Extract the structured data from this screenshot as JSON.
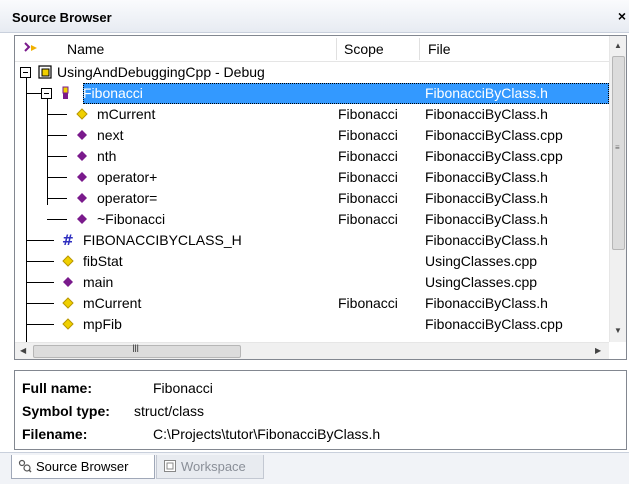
{
  "window": {
    "title": "Source Browser",
    "close_glyph": "×"
  },
  "columns": {
    "name": "Name",
    "scope": "Scope",
    "file": "File"
  },
  "rows": [
    {
      "name": "UsingAndDebuggingCpp - Debug",
      "scope": "",
      "file": "",
      "icon": "project-icon",
      "level": 0,
      "expander": "minus"
    },
    {
      "name": "Fibonacci",
      "scope": "",
      "file": "FibonacciByClass.h",
      "icon": "class-icon",
      "level": 1,
      "expander": "minus",
      "selected": true
    },
    {
      "name": "mCurrent",
      "scope": "Fibonacci",
      "file": "FibonacciByClass.h",
      "icon": "variable-icon",
      "level": 2
    },
    {
      "name": "next",
      "scope": "Fibonacci",
      "file": "FibonacciByClass.cpp",
      "icon": "function-icon",
      "level": 2
    },
    {
      "name": "nth",
      "scope": "Fibonacci",
      "file": "FibonacciByClass.cpp",
      "icon": "function-icon",
      "level": 2
    },
    {
      "name": "operator+",
      "scope": "Fibonacci",
      "file": "FibonacciByClass.h",
      "icon": "function-icon",
      "level": 2
    },
    {
      "name": "operator=",
      "scope": "Fibonacci",
      "file": "FibonacciByClass.h",
      "icon": "function-icon",
      "level": 2
    },
    {
      "name": "~Fibonacci",
      "scope": "Fibonacci",
      "file": "FibonacciByClass.h",
      "icon": "function-icon",
      "level": 2
    },
    {
      "name": "FIBONACCIBYCLASS_H",
      "scope": "",
      "file": "FibonacciByClass.h",
      "icon": "macro-icon",
      "level": 1
    },
    {
      "name": "fibStat",
      "scope": "",
      "file": "UsingClasses.cpp",
      "icon": "variable-icon",
      "level": 1
    },
    {
      "name": "main",
      "scope": "",
      "file": "UsingClasses.cpp",
      "icon": "function-icon",
      "level": 1
    },
    {
      "name": "mCurrent",
      "scope": "Fibonacci",
      "file": "FibonacciByClass.h",
      "icon": "variable-icon",
      "level": 1
    },
    {
      "name": "mpFib",
      "scope": "",
      "file": "FibonacciByClass.cpp",
      "icon": "variable-icon",
      "level": 1
    }
  ],
  "details": {
    "full_name_label": "Full name:",
    "full_name": "Fibonacci",
    "symbol_type_label": "Symbol type:",
    "symbol_type": "struct/class",
    "filename_label": "Filename:",
    "filename": "C:\\Projects\\tutor\\FibonacciByClass.h"
  },
  "tabs": [
    {
      "label": "Source Browser",
      "icon": "source-browser-icon",
      "active": true
    },
    {
      "label": "Workspace",
      "icon": "workspace-icon",
      "active": false
    }
  ],
  "scrollbar": {
    "hgrip": "III"
  },
  "colors": {
    "selection": "#3399ff",
    "function": "#7a1a8c",
    "variable": "#f0d000",
    "macro": "#3030c0"
  }
}
